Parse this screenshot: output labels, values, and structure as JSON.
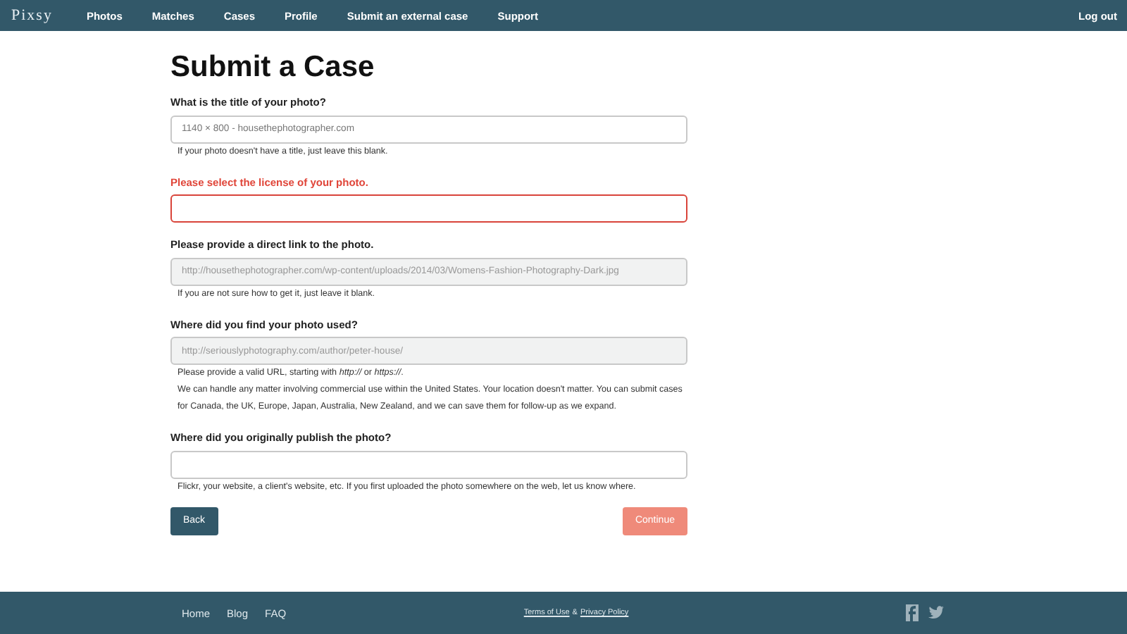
{
  "nav": {
    "logo": "Pixsy",
    "links": [
      "Photos",
      "Matches",
      "Cases",
      "Profile",
      "Submit an external case",
      "Support"
    ],
    "logout": "Log out"
  },
  "heading": "Submit a Case",
  "fields": [
    {
      "label": "What is the title of your photo?",
      "value": "1140 × 800 - housethephotographer.com",
      "error": false,
      "disabled": false,
      "help": [
        "If your photo doesn't have a title, just leave this blank."
      ]
    },
    {
      "label": "Please select the license of your photo.",
      "error": true,
      "disabled": false
    },
    {
      "label": "Please provide a direct link to the photo.",
      "placeholder": "http://housethephotographer.com/wp-content/uploads/2014/03/Womens-Fashion-Photography-Dark.jpg",
      "error": false,
      "disabled": true,
      "help": [
        "If you are not sure how to get it, just leave it blank."
      ]
    },
    {
      "label": "Where did you find your photo used?",
      "placeholder": "http://seriouslyphotography.com/author/peter-house/",
      "error": false,
      "disabled": true,
      "help": [
        "Please provide a valid URL, starting with *http://* or *https://*.",
        "We can handle any matter involving commercial use within the United States. Your location doesn't matter. You can submit cases for Canada, the UK, Europe, Japan, Australia, New Zealand, and we can save them for follow-up as we expand."
      ]
    },
    {
      "label": "Where did you originally publish the photo?",
      "error": false,
      "disabled": false,
      "help": [
        "Flickr, your website, a client's website, etc. If you first uploaded the photo somewhere on the web, let us know where."
      ]
    }
  ],
  "buttons": {
    "back": {
      "label": "Back"
    },
    "continue": {
      "label": "Continue",
      "disabled": true
    }
  },
  "footer": {
    "links": [
      "Home",
      "Blog",
      "FAQ"
    ],
    "terms": "Terms of Use",
    "amp": "&",
    "privacy": "Privacy Policy"
  }
}
